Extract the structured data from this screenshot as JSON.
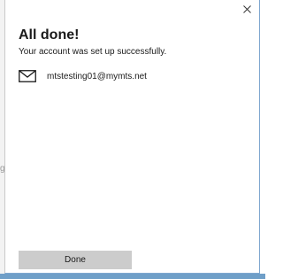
{
  "dialog": {
    "title": "All done!",
    "subtitle": "Your account was set up successfully.",
    "account_email": "mtstesting01@mymts.net",
    "done_label": "Done",
    "close_icon": "close-icon",
    "mail_icon": "envelope-icon"
  },
  "background": {
    "left_edge_glyph": "g"
  },
  "colors": {
    "button_bg": "#cccccc",
    "accent_border": "#7fa7cf"
  }
}
